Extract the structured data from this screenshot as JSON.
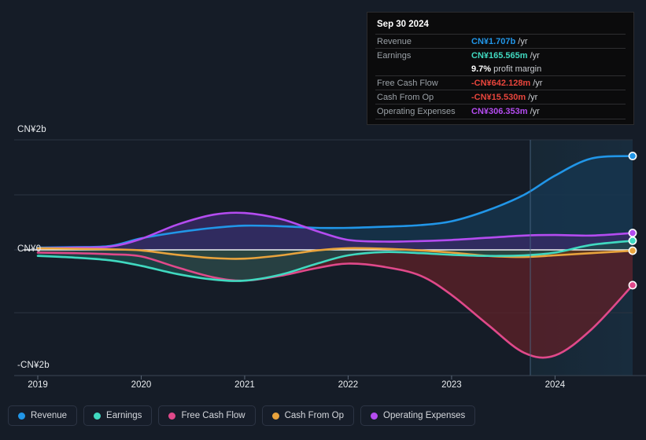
{
  "chart_data": {
    "type": "area",
    "title": "",
    "xlabel": "",
    "ylabel": "",
    "ylim": [
      -2000000000,
      2000000000
    ],
    "ytick_labels": [
      "CN¥2b",
      "CN¥0",
      "-CN¥2b"
    ],
    "xtick_labels": [
      "2019",
      "2020",
      "2021",
      "2022",
      "2023",
      "2024"
    ],
    "grid": true,
    "legend_position": "bottom",
    "currency": "CN¥",
    "series": [
      {
        "name": "Revenue",
        "color": "#2196e8",
        "fill": "#16364f",
        "x": [
          2019.0,
          2019.35,
          2019.7,
          2020.0,
          2020.35,
          2020.7,
          2021.0,
          2021.35,
          2021.7,
          2022.0,
          2022.35,
          2022.7,
          2023.0,
          2023.35,
          2023.7,
          2024.0,
          2024.35,
          2024.75
        ],
        "values": [
          0.04,
          0.05,
          0.07,
          0.21,
          0.32,
          0.4,
          0.44,
          0.43,
          0.4,
          0.4,
          0.42,
          0.45,
          0.52,
          0.72,
          1.0,
          1.35,
          1.66,
          1.707
        ],
        "endpoint_value": "CN¥1.707b"
      },
      {
        "name": "Earnings",
        "color": "#40d9c0",
        "fill": "#1d4a4a",
        "x": [
          2019.0,
          2019.35,
          2019.7,
          2020.0,
          2020.35,
          2020.7,
          2021.0,
          2021.35,
          2021.7,
          2022.0,
          2022.35,
          2022.7,
          2023.0,
          2023.35,
          2023.7,
          2024.0,
          2024.35,
          2024.75
        ],
        "values": [
          -0.11,
          -0.14,
          -0.19,
          -0.29,
          -0.44,
          -0.54,
          -0.56,
          -0.45,
          -0.25,
          -0.1,
          -0.04,
          -0.06,
          -0.09,
          -0.11,
          -0.1,
          -0.05,
          0.09,
          0.1656
        ],
        "endpoint_value": "CN¥165.565m"
      },
      {
        "name": "Free Cash Flow",
        "color": "#e0498a",
        "fill": "#5c2028",
        "x": [
          2019.0,
          2019.35,
          2019.7,
          2020.0,
          2020.35,
          2020.7,
          2021.0,
          2021.35,
          2021.7,
          2022.0,
          2022.35,
          2022.7,
          2023.0,
          2023.35,
          2023.7,
          2024.0,
          2024.35,
          2024.75
        ],
        "values": [
          -0.05,
          -0.06,
          -0.08,
          -0.12,
          -0.32,
          -0.5,
          -0.56,
          -0.47,
          -0.33,
          -0.25,
          -0.31,
          -0.47,
          -0.82,
          -1.36,
          -1.87,
          -1.92,
          -1.45,
          -0.642
        ],
        "endpoint_value": "-CN¥642.128m"
      },
      {
        "name": "Cash From Op",
        "color": "#e8a33d",
        "fill": "#5c3a1c",
        "x": [
          2019.0,
          2019.35,
          2019.7,
          2020.0,
          2020.35,
          2020.7,
          2021.0,
          2021.35,
          2021.7,
          2022.0,
          2022.35,
          2022.7,
          2023.0,
          2023.35,
          2023.7,
          2024.0,
          2024.35,
          2024.75
        ],
        "values": [
          0.03,
          0.02,
          0.01,
          -0.01,
          -0.09,
          -0.15,
          -0.16,
          -0.1,
          -0.01,
          0.03,
          0.02,
          -0.01,
          -0.05,
          -0.11,
          -0.13,
          -0.1,
          -0.06,
          -0.0155
        ],
        "endpoint_value": "-CN¥15.530m"
      },
      {
        "name": "Operating Expenses",
        "color": "#b44cf0",
        "fill": "#382a66",
        "x": [
          2019.0,
          2019.35,
          2019.7,
          2020.0,
          2020.35,
          2020.7,
          2021.0,
          2021.35,
          2021.7,
          2022.0,
          2022.35,
          2022.7,
          2023.0,
          2023.35,
          2023.7,
          2024.0,
          2024.35,
          2024.75
        ],
        "values": [
          0.03,
          0.04,
          0.06,
          0.2,
          0.46,
          0.64,
          0.67,
          0.56,
          0.34,
          0.18,
          0.15,
          0.16,
          0.18,
          0.22,
          0.26,
          0.27,
          0.26,
          0.3064
        ],
        "endpoint_value": "CN¥306.353m"
      }
    ]
  },
  "tooltip": {
    "date": "Sep 30 2024",
    "rows": [
      {
        "label": "Revenue",
        "value": "CN¥1.707b",
        "unit": "/yr",
        "color": "#2196e8"
      },
      {
        "label": "Earnings",
        "value": "CN¥165.565m",
        "unit": "/yr",
        "color": "#40d9c0"
      },
      {
        "label": "",
        "value": "9.7%",
        "unit": "profit margin",
        "color": "#ffffff"
      },
      {
        "label": "Free Cash Flow",
        "value": "-CN¥642.128m",
        "unit": "/yr",
        "color": "#e8453c"
      },
      {
        "label": "Cash From Op",
        "value": "-CN¥15.530m",
        "unit": "/yr",
        "color": "#e8453c"
      },
      {
        "label": "Operating Expenses",
        "value": "CN¥306.353m",
        "unit": "/yr",
        "color": "#b44cf0"
      }
    ]
  },
  "legend": {
    "items": [
      {
        "label": "Revenue",
        "color": "#2196e8"
      },
      {
        "label": "Earnings",
        "color": "#40d9c0"
      },
      {
        "label": "Free Cash Flow",
        "color": "#e0498a"
      },
      {
        "label": "Cash From Op",
        "color": "#e8a33d"
      },
      {
        "label": "Operating Expenses",
        "color": "#b44cf0"
      }
    ]
  }
}
